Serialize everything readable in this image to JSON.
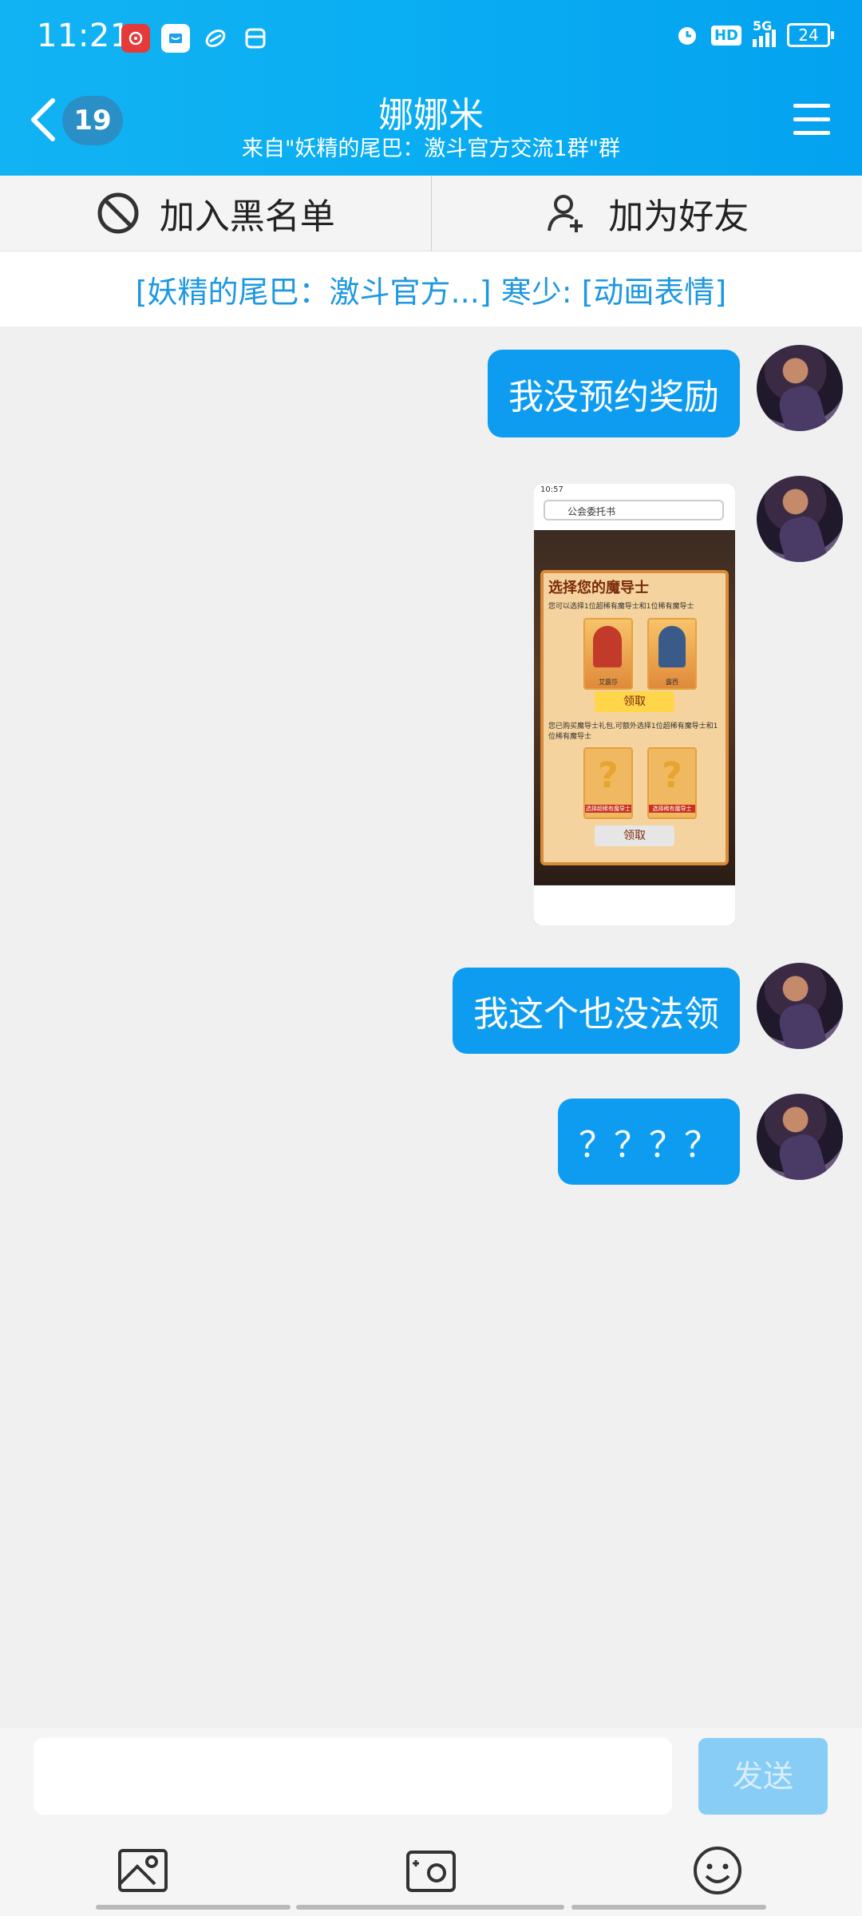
{
  "status_bar": {
    "time": "11:21",
    "hd_label": "HD",
    "network": "5G",
    "battery": "24"
  },
  "header": {
    "back_count": "19",
    "title": "娜娜米",
    "subtitle": "来自\"妖精的尾巴：激斗官方交流1群\"群"
  },
  "actions": {
    "blacklist_label": "加入黑名单",
    "add_friend_label": "加为好友"
  },
  "notice": {
    "text": "[妖精的尾巴：激斗官方...] 寒少: [动画表情]"
  },
  "messages": [
    {
      "type": "text",
      "text": "我没预约奖励"
    },
    {
      "type": "image"
    },
    {
      "type": "text",
      "text": "我这个也没法领"
    },
    {
      "type": "text",
      "text": "？？？？"
    }
  ],
  "image_message": {
    "time": "10:57",
    "search_text": "公会委托书",
    "panel_title": "选择您的魔导士",
    "line1": "您可以选择1位超稀有魔导士和1位稀有魔导士",
    "card_left": "艾露莎",
    "card_right": "露西",
    "claim_label": "领取",
    "line2": "您已购买魔导士礼包,可额外选择1位超稀有魔导士和1位稀有魔导士",
    "card_q_left": "选择超稀有魔导士",
    "card_q_right": "选择稀有魔导士",
    "claim_label_2": "领取"
  },
  "input": {
    "placeholder": "",
    "send_label": "发送"
  },
  "icons": {
    "back": "chevron-left-icon",
    "menu": "hamburger-icon",
    "block": "block-icon",
    "add_user": "add-user-icon",
    "image": "image-icon",
    "camera": "camera-icon",
    "emoji": "emoji-icon"
  },
  "colors": {
    "header_blue": "#0aaef2",
    "bubble_blue": "#0e9cf1",
    "notice_blue": "#1e98e0",
    "send_disabled": "#88cdf6"
  }
}
